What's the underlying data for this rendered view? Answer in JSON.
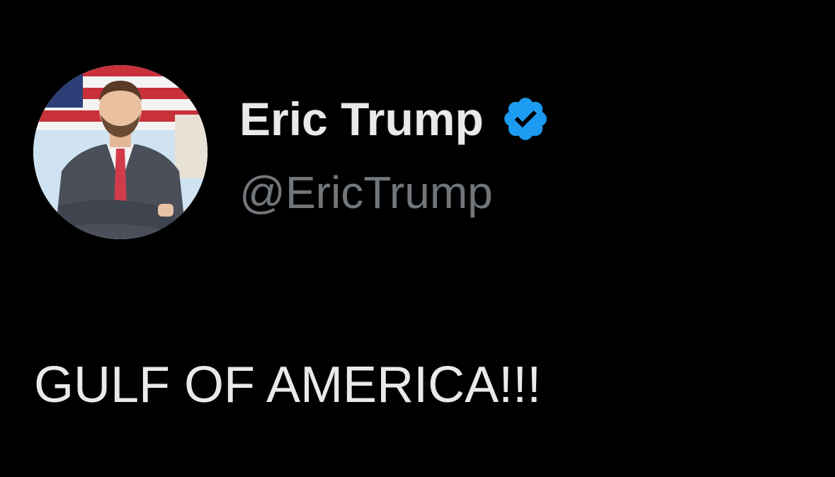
{
  "tweet": {
    "author": {
      "display_name": "Eric Trump",
      "handle": "@EricTrump",
      "verified": true,
      "verified_badge_icon": "verified-badge-icon",
      "avatar_icon": "profile-avatar"
    },
    "text": "GULF OF AMERICA!!!"
  },
  "colors": {
    "background": "#000000",
    "primary_text": "#e7e9ea",
    "secondary_text": "#71767b",
    "verified_blue": "#1d9bf0"
  }
}
